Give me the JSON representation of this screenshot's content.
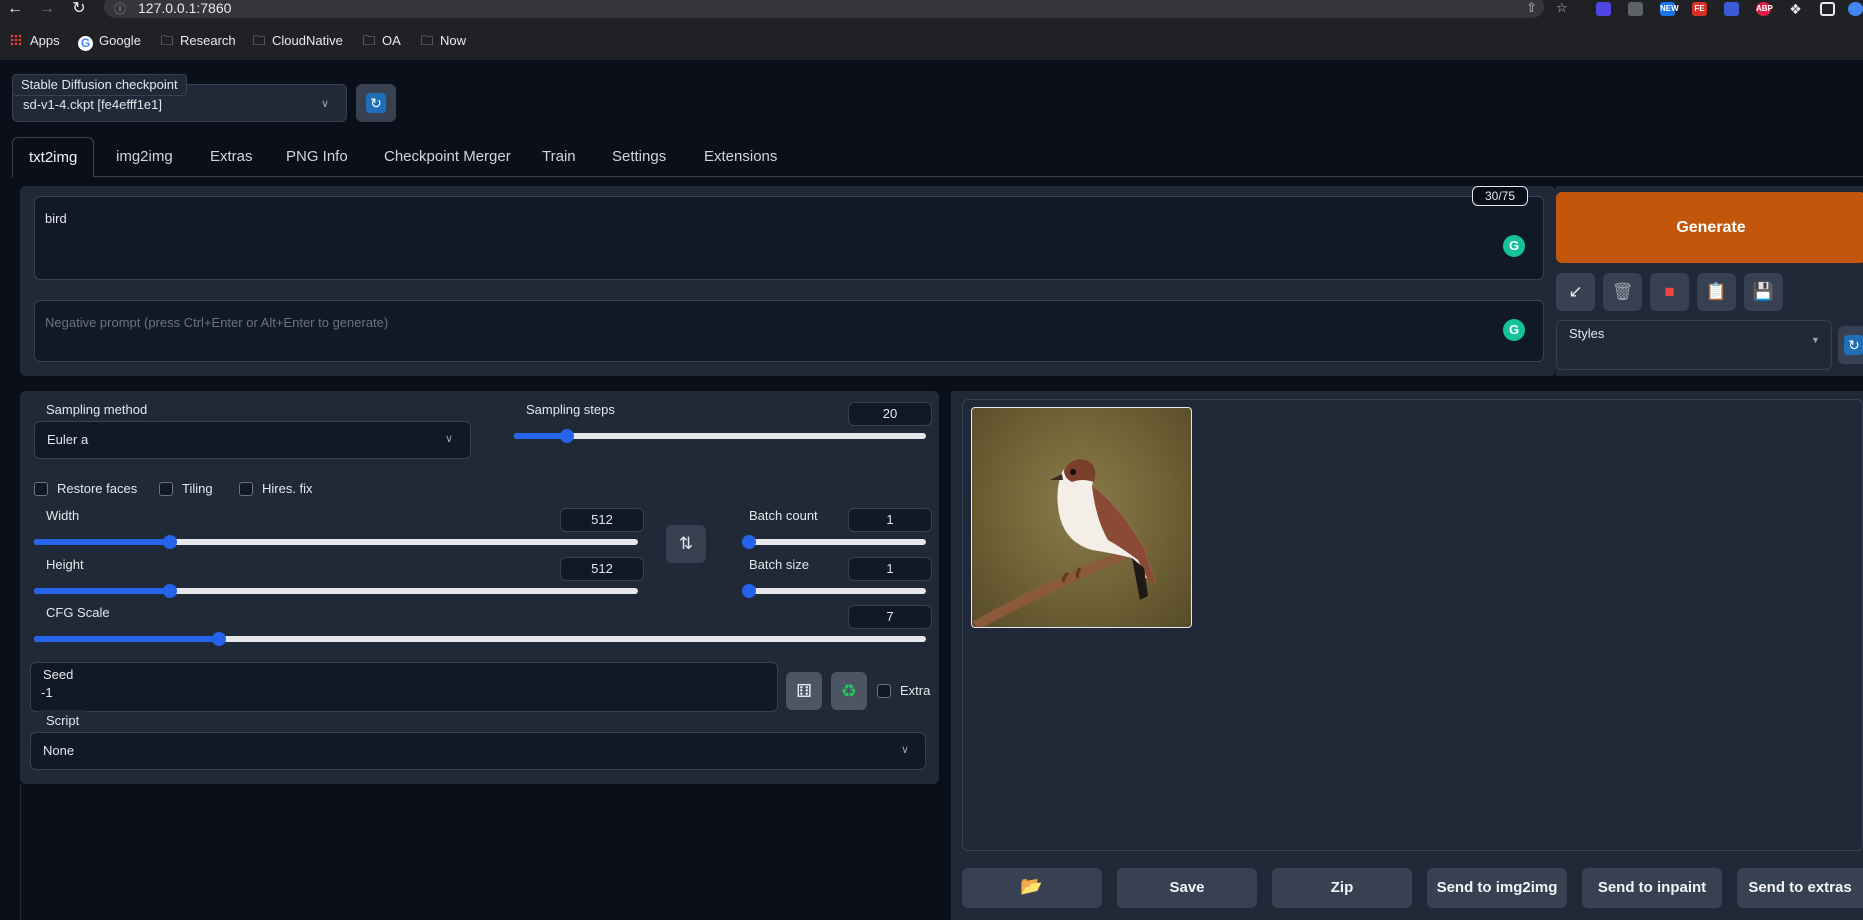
{
  "browser": {
    "url": "127.0.0.1:7860",
    "bookmarks": [
      "Apps",
      "Google",
      "Research",
      "CloudNative",
      "OA",
      "Now"
    ],
    "extensions": [
      "NEW",
      "FE",
      "ABP"
    ]
  },
  "checkpoint": {
    "label": "Stable Diffusion checkpoint",
    "value": "sd-v1-4.ckpt [fe4efff1e1]"
  },
  "tabs": [
    "txt2img",
    "img2img",
    "Extras",
    "PNG Info",
    "Checkpoint Merger",
    "Train",
    "Settings",
    "Extensions"
  ],
  "prompt": {
    "text": "bird",
    "token_count": "30/75",
    "negative_placeholder": "Negative prompt (press Ctrl+Enter or Alt+Enter to generate)"
  },
  "actions": {
    "generate_label": "Generate",
    "styles_label": "Styles"
  },
  "params": {
    "sampling_method_label": "Sampling method",
    "sampling_method_value": "Euler a",
    "sampling_steps_label": "Sampling steps",
    "sampling_steps_value": "20",
    "sampling_steps": {
      "min": 1,
      "max": 150,
      "value": 20
    },
    "restore_faces_label": "Restore faces",
    "tiling_label": "Tiling",
    "hires_label": "Hires. fix",
    "width_label": "Width",
    "width_value": "512",
    "width": {
      "min": 64,
      "max": 2048,
      "value": 512
    },
    "height_label": "Height",
    "height_value": "512",
    "height": {
      "min": 64,
      "max": 2048,
      "value": 512
    },
    "batch_count_label": "Batch count",
    "batch_count_value": "1",
    "batch_count": {
      "min": 1,
      "max": 100,
      "value": 1
    },
    "batch_size_label": "Batch size",
    "batch_size_value": "1",
    "batch_size": {
      "min": 1,
      "max": 8,
      "value": 1
    },
    "cfg_label": "CFG Scale",
    "cfg_value": "7",
    "cfg": {
      "min": 1,
      "max": 30,
      "value": 7
    },
    "seed_label": "Seed",
    "seed_value": "-1",
    "extra_label": "Extra",
    "script_label": "Script",
    "script_value": "None"
  },
  "output_buttons": [
    "",
    "Save",
    "Zip",
    "Send to img2img",
    "Send to inpaint",
    "Send to extras"
  ],
  "colors": {
    "accent": "#2563eb",
    "generate": "#c2570c",
    "panel": "#1f2937",
    "background": "#0b0f19"
  }
}
